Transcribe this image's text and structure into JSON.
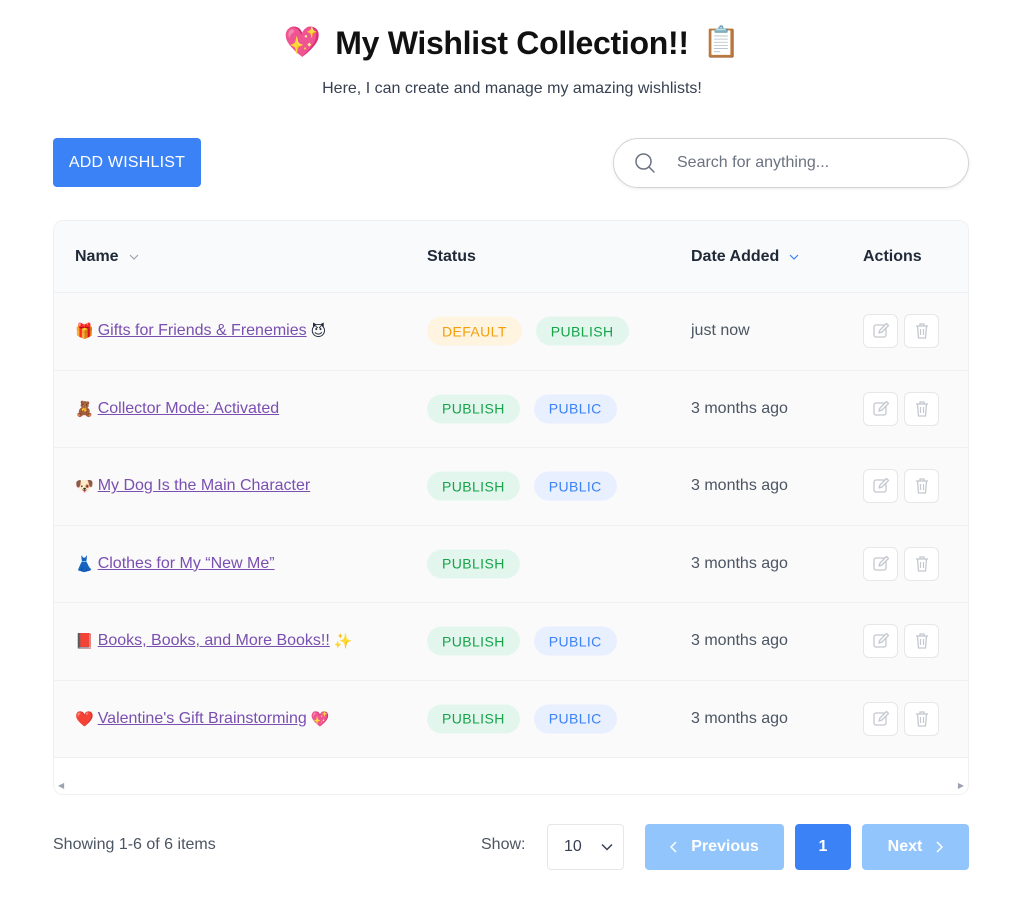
{
  "header": {
    "title": "My Wishlist Collection!!",
    "title_emoji_left": "💖",
    "title_emoji_right": "📋",
    "subtitle": "Here, I can create and manage my amazing wishlists!"
  },
  "toolbar": {
    "add_label": "ADD WISHLIST",
    "search_placeholder": "Search for anything...",
    "accent": "#3b82f6"
  },
  "table": {
    "columns": {
      "name": "Name",
      "status": "Status",
      "date": "Date Added",
      "actions": "Actions"
    },
    "rows": [
      {
        "emoji": "🎁",
        "name": "Gifts for Friends & Frenemies",
        "trail": "😈",
        "badges": [
          "DEFAULT",
          "PUBLISH"
        ],
        "date": "just now"
      },
      {
        "emoji": "🧸",
        "name": "Collector Mode: Activated",
        "trail": "",
        "badges": [
          "PUBLISH",
          "PUBLIC"
        ],
        "date": "3 months ago"
      },
      {
        "emoji": "🐶",
        "name": "My Dog Is the Main Character",
        "trail": "",
        "badges": [
          "PUBLISH",
          "PUBLIC"
        ],
        "date": "3 months ago"
      },
      {
        "emoji": "👗",
        "name": "Clothes for My “New Me”",
        "trail": "",
        "badges": [
          "PUBLISH"
        ],
        "date": "3 months ago"
      },
      {
        "emoji": "📕",
        "name": "Books, Books, and More Books!!",
        "trail": "✨",
        "badges": [
          "PUBLISH",
          "PUBLIC"
        ],
        "date": "3 months ago"
      },
      {
        "emoji": "❤️",
        "name": "Valentine's Gift Brainstorming",
        "trail": "💖",
        "badges": [
          "PUBLISH",
          "PUBLIC"
        ],
        "date": "3 months ago"
      }
    ]
  },
  "footer": {
    "showing": "Showing 1-6 of 6 items",
    "show_label": "Show:",
    "page_size": "10",
    "prev_label": "Previous",
    "current_page": "1",
    "next_label": "Next"
  }
}
